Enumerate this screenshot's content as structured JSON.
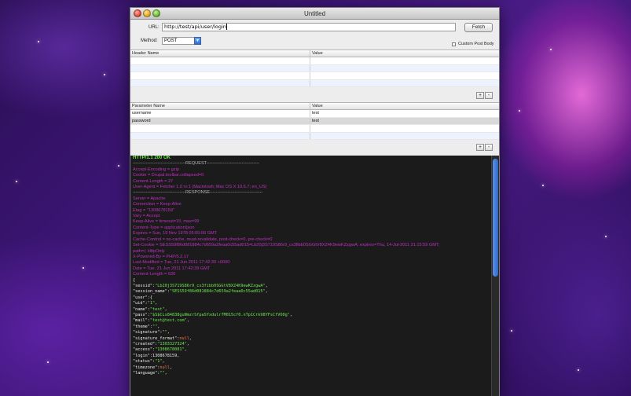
{
  "window": {
    "title": "Untitled"
  },
  "request_form": {
    "url_label": "URL:",
    "url_value": "http://test/api/user/login",
    "fetch_label": "Fetch",
    "method_label": "Method:",
    "method_value": "POST",
    "custom_body_label": "Custom Post Body",
    "custom_body_checked": false
  },
  "header_table": {
    "columns": [
      "Header Name",
      "Value"
    ],
    "rows": [
      {
        "name": "",
        "value": ""
      },
      {
        "name": "",
        "value": ""
      },
      {
        "name": "",
        "value": ""
      },
      {
        "name": "",
        "value": ""
      }
    ],
    "add_label": "+",
    "remove_label": "-"
  },
  "param_table": {
    "columns": [
      "Parameter Name",
      "Value"
    ],
    "rows": [
      {
        "name": "username",
        "value": "test"
      },
      {
        "name": "password",
        "value": "test"
      },
      {
        "name": "",
        "value": ""
      },
      {
        "name": "",
        "value": ""
      }
    ],
    "add_label": "+",
    "remove_label": "-"
  },
  "response": {
    "status_line": "HTTP/1.1 200 OK",
    "request_separator": "------------------------------------REQUEST------------------------------------",
    "request_headers": [
      "Accept-Encoding = gzip",
      "Cookie = Drupal.toolbar.collapsed=0",
      "Content-Length = 27",
      "User-Agent = Fetcher 1.0 rv:1 (Macintosh; Mac OS X 10.6.7; en_US)"
    ],
    "response_separator": "------------------------------------RESPONSE------------------------------------",
    "response_headers": [
      "Server = Apache",
      "Connection = Keep-Alive",
      "Etag = \"1308678159\"",
      "Vary = Accept",
      "Keep-Alive = timeout=15, max=99",
      "Content-Type = application/json",
      "Expires = Sun, 19 Nov 1978 05:00:00 GMT",
      "Cache-Control = no-cache, must-revalidate, post-check=0, pre-check=0",
      "Set-Cookie = SESS59f86d081884c7d659a2feaa0c55ad015=Lb20j3S719S86r9_cx3fibb0SGGtV8XZ4K9ewKZzgwA; expires=Thu, 14-Jul-2011 21:15:59 GMT;",
      "path=/; HttpOnly",
      "X-Powered-By = PHP/5.2.17",
      "Last-Modified = Tue, 21 Jun 2011 17:42:39 +0000",
      "Date = Tue, 21 Jun 2011 17:42:39 GMT",
      "Content-Length = 630"
    ],
    "json_lines": [
      [
        {
          "t": "{",
          "c": "k"
        }
      ],
      [
        {
          "t": "  \"sessid\":",
          "c": "k"
        },
        {
          "t": "\"Lb20j3S719S86r9_cx3fibb0SGGtV8XZ4K9ewKZzgwA\"",
          "c": "s"
        },
        {
          "t": ",",
          "c": "k"
        }
      ],
      [
        {
          "t": "  \"session_name\":",
          "c": "k"
        },
        {
          "t": "\"SESS59f86d081884c7d659a2feaa0c55ad015\"",
          "c": "s"
        },
        {
          "t": ",",
          "c": "k"
        }
      ],
      [
        {
          "t": "  \"user\":{",
          "c": "k"
        }
      ],
      [
        {
          "t": "    \"uid\":",
          "c": "k"
        },
        {
          "t": "\"1\"",
          "c": "s"
        },
        {
          "t": ",",
          "c": "k"
        }
      ],
      [
        {
          "t": "    \"name\":",
          "c": "k"
        },
        {
          "t": "\"test\"",
          "c": "s"
        },
        {
          "t": ",",
          "c": "k"
        }
      ],
      [
        {
          "t": "    \"pass\":",
          "c": "k"
        },
        {
          "t": "\"$S$CLs84838guNmzrSfpaSYxdulr7M015cf0.nTp1Crk98YFsCfVO0g\"",
          "c": "s"
        },
        {
          "t": ",",
          "c": "k"
        }
      ],
      [
        {
          "t": "    \"mail\":",
          "c": "k"
        },
        {
          "t": "\"test@test.com\"",
          "c": "s"
        },
        {
          "t": ",",
          "c": "k"
        }
      ],
      [
        {
          "t": "    \"theme\":",
          "c": "k"
        },
        {
          "t": "\"\"",
          "c": "s"
        },
        {
          "t": ",",
          "c": "k"
        }
      ],
      [
        {
          "t": "    \"signature\":",
          "c": "k"
        },
        {
          "t": "\"\"",
          "c": "s"
        },
        {
          "t": ",",
          "c": "k"
        }
      ],
      [
        {
          "t": "    \"signature_format\":",
          "c": "k"
        },
        {
          "t": "null",
          "c": "o"
        },
        {
          "t": ",",
          "c": "k"
        }
      ],
      [
        {
          "t": "    \"created\":",
          "c": "k"
        },
        {
          "t": "\"1303327324\"",
          "c": "s"
        },
        {
          "t": ",",
          "c": "k"
        }
      ],
      [
        {
          "t": "    \"access\":",
          "c": "k"
        },
        {
          "t": "\"1308678081\"",
          "c": "s"
        },
        {
          "t": ",",
          "c": "k"
        }
      ],
      [
        {
          "t": "    \"login\":",
          "c": "k"
        },
        {
          "t": "1308678159",
          "c": "n"
        },
        {
          "t": ",",
          "c": "k"
        }
      ],
      [
        {
          "t": "    \"status\":",
          "c": "k"
        },
        {
          "t": "\"1\"",
          "c": "s"
        },
        {
          "t": ",",
          "c": "k"
        }
      ],
      [
        {
          "t": "    \"timezone\":",
          "c": "k"
        },
        {
          "t": "null",
          "c": "o"
        },
        {
          "t": ",",
          "c": "k"
        }
      ],
      [
        {
          "t": "    \"language\":",
          "c": "k"
        },
        {
          "t": "\"\"",
          "c": "s"
        },
        {
          "t": ",",
          "c": "k"
        }
      ]
    ]
  },
  "colors": {
    "console_bg": "#1b1b1b",
    "status_green": "#6ee84e",
    "header_magenta": "#c12ec2",
    "json_string": "#6ee84e",
    "json_null": "#ff7a4d",
    "selection_blue": "#2e69cc"
  }
}
